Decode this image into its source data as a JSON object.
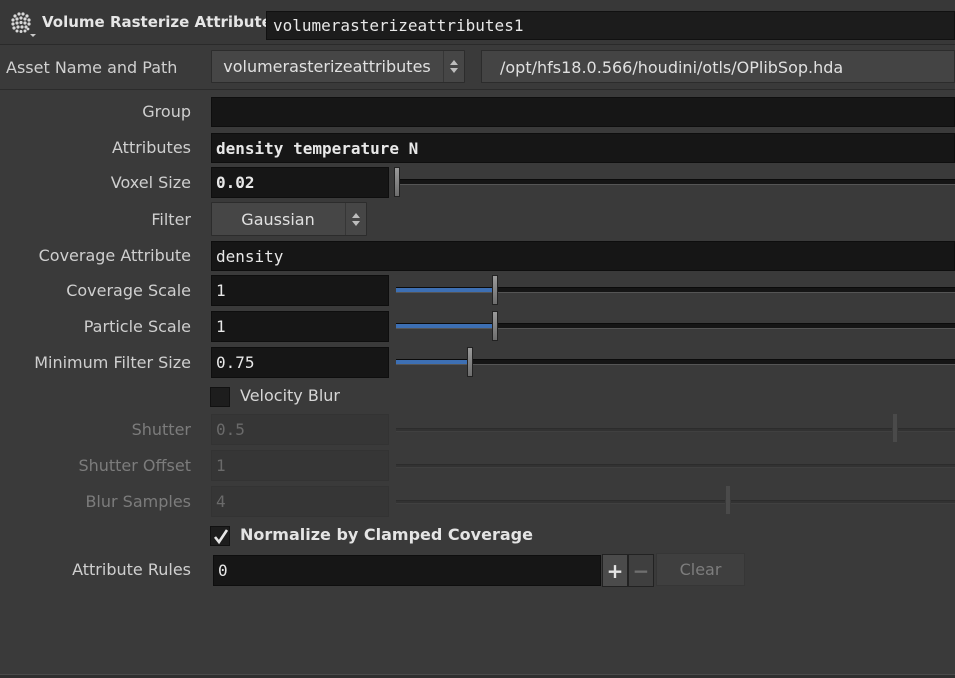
{
  "header": {
    "node_type_label": "Volume Rasterize Attributes",
    "node_name": "volumerasterizeattributes1"
  },
  "asset": {
    "label": "Asset Name and Path",
    "name_menu": "volumerasterizeattributes",
    "path": "/opt/hfs18.0.566/houdini/otls/OPlibSop.hda"
  },
  "params": {
    "group": {
      "label": "Group",
      "value": ""
    },
    "attributes": {
      "label": "Attributes",
      "value": "density temperature N"
    },
    "voxel_size": {
      "label": "Voxel Size",
      "value": "0.02",
      "slider_fraction": 0.0
    },
    "filter": {
      "label": "Filter",
      "value": "Gaussian"
    },
    "coverage_attribute": {
      "label": "Coverage Attribute",
      "value": "density"
    },
    "coverage_scale": {
      "label": "Coverage Scale",
      "value": "1",
      "slider_fraction": 0.18
    },
    "particle_scale": {
      "label": "Particle Scale",
      "value": "1",
      "slider_fraction": 0.18
    },
    "minimum_filter_size": {
      "label": "Minimum Filter Size",
      "value": "0.75",
      "slider_fraction": 0.13
    },
    "velocity_blur": {
      "label": "Velocity Blur",
      "checked": false
    },
    "shutter": {
      "label": "Shutter",
      "value": "0.5",
      "slider_fraction": 0.89,
      "disabled": true
    },
    "shutter_offset": {
      "label": "Shutter Offset",
      "value": "1",
      "disabled": true
    },
    "blur_samples": {
      "label": "Blur Samples",
      "value": "4",
      "slider_fraction": 0.59,
      "disabled": true
    },
    "normalize": {
      "label": "Normalize by Clamped Coverage",
      "checked": true
    },
    "attribute_rules": {
      "label": "Attribute Rules",
      "value": "0",
      "clear_label": "Clear"
    }
  },
  "colors": {
    "background": "#3a3a3a",
    "field": "#161616",
    "slider_fill": "#3d6fb3"
  }
}
